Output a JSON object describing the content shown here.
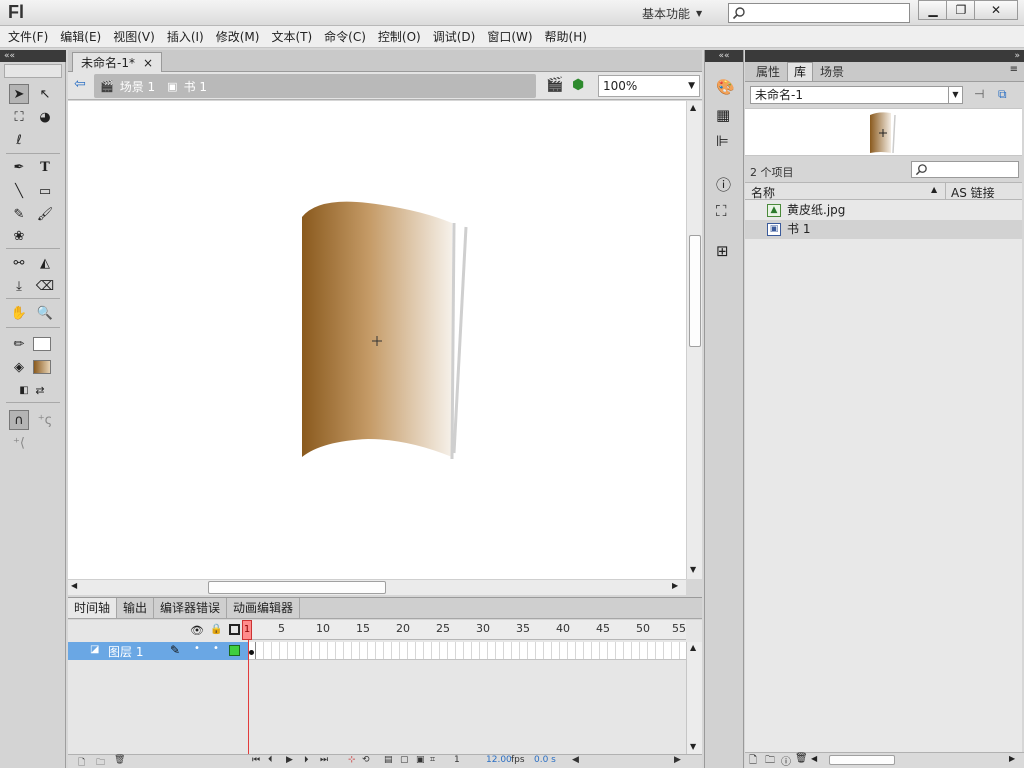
{
  "app": {
    "logo": "Fl",
    "workspace": "基本功能"
  },
  "menu": [
    "文件(F)",
    "编辑(E)",
    "视图(V)",
    "插入(I)",
    "修改(M)",
    "文本(T)",
    "命令(C)",
    "控制(O)",
    "调试(D)",
    "窗口(W)",
    "帮助(H)"
  ],
  "document": {
    "tab_title": "未命名-1*",
    "tab_close": "×",
    "breadcrumb": [
      "场景 1",
      "书 1"
    ],
    "zoom": "100%"
  },
  "timeline": {
    "tabs": [
      "时间轴",
      "输出",
      "编译器错误",
      "动画编辑器"
    ],
    "frame_numbers": [
      "1",
      "5",
      "10",
      "15",
      "20",
      "25",
      "30",
      "35",
      "40",
      "45",
      "50",
      "55"
    ],
    "current_frame_marker": "1",
    "layer_name": "图层 1",
    "status_frame": "1",
    "status_fps": "12.00",
    "status_fps_unit": "fps",
    "status_time": "0.0 s"
  },
  "library": {
    "tabs": [
      "属性",
      "库",
      "场景"
    ],
    "document_name": "未命名-1",
    "item_count": "2 个项目",
    "columns": {
      "name": "名称",
      "linkage": "AS 链接"
    },
    "items": [
      {
        "name": "黄皮纸.jpg",
        "type": "bitmap"
      },
      {
        "name": "书 1",
        "type": "movieclip"
      }
    ]
  },
  "colors": {
    "book_dark": "#8a5a1e",
    "book_light": "#f6f1ea",
    "layer_highlight": "#6aa7e4",
    "playhead": "#e23b3b"
  }
}
